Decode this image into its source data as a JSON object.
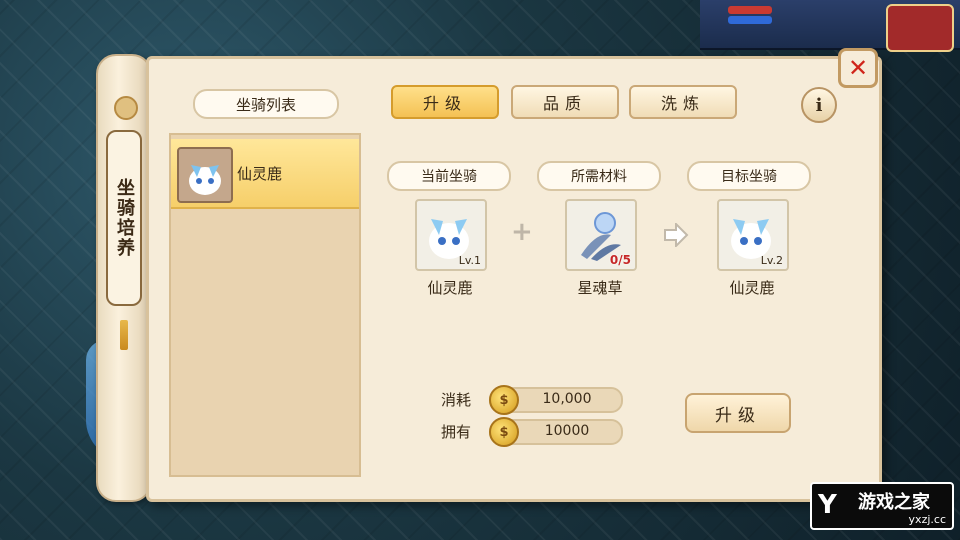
{
  "sidebar_tab": {
    "label": "坐骑培养"
  },
  "mount_list": {
    "title": "坐骑列表",
    "items": [
      {
        "name": "仙灵鹿"
      }
    ]
  },
  "tabs": [
    {
      "label": "升级",
      "active": true
    },
    {
      "label": "品质",
      "active": false
    },
    {
      "label": "洗炼",
      "active": false
    }
  ],
  "info_button": {
    "label": "i"
  },
  "close_button": {
    "label": "✕"
  },
  "upgrade": {
    "current": {
      "header": "当前坐骑",
      "level": "Lv.1",
      "name": "仙灵鹿"
    },
    "material": {
      "header": "所需材料",
      "count": "0/5",
      "name": "星魂草"
    },
    "target": {
      "header": "目标坐骑",
      "level": "Lv.2",
      "name": "仙灵鹿"
    }
  },
  "cost": {
    "consume_label": "消耗",
    "consume_value": "10,000",
    "own_label": "拥有",
    "own_value": "10000"
  },
  "upgrade_button": {
    "label": "升级"
  },
  "logo": {
    "brand": "游戏之家",
    "url": "yxzj.cc"
  },
  "colors": {
    "panel": "#f6ecd9",
    "active_tab": "#f4c154",
    "close_x": "#d0251b",
    "material_count": "#c62828"
  }
}
